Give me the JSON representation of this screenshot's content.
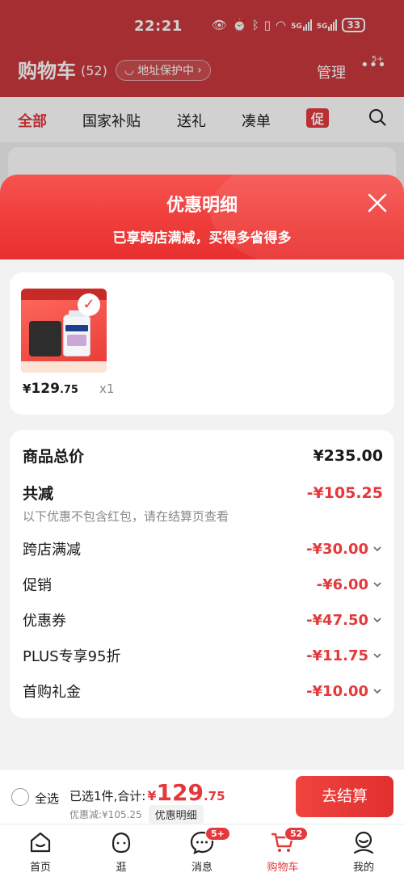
{
  "status_bar": {
    "time": "22:21",
    "battery": "33"
  },
  "header": {
    "title": "购物车",
    "count": "(52)",
    "address_protect": "地址保护中",
    "manage": "管理",
    "more_badge": "5+"
  },
  "tabs": [
    {
      "label": "全部"
    },
    {
      "label": "国家补贴"
    },
    {
      "label": "送礼"
    },
    {
      "label": "凑单"
    }
  ],
  "promo_tab": "促",
  "sheet": {
    "title": "优惠明细",
    "subtitle": "已享跨店满减，买得多省得多"
  },
  "product": {
    "currency": "¥",
    "price_int": "129",
    "price_dec": ".75",
    "qty": "x1"
  },
  "breakdown": {
    "total_label": "商品总价",
    "total_value": "¥235.00",
    "reduce_label": "共减",
    "reduce_value": "-¥105.25",
    "note": "以下优惠不包含红包，请在结算页查看",
    "items": [
      {
        "label": "跨店满减",
        "value": "-¥30.00"
      },
      {
        "label": "促销",
        "value": "-¥6.00"
      },
      {
        "label": "优惠券",
        "value": "-¥47.50"
      },
      {
        "label": "PLUS专享95折",
        "value": "-¥11.75"
      },
      {
        "label": "首购礼金",
        "value": "-¥10.00"
      }
    ]
  },
  "checkout": {
    "select_all": "全选",
    "selected_text": "已选1件,合计:",
    "total_currency": "¥",
    "total_int": "129",
    "total_dec": ".75",
    "reduced_text": "优惠减:¥105.25",
    "detail_pill": "优惠明细",
    "button": "去结算"
  },
  "nav": [
    {
      "label": "首页"
    },
    {
      "label": "逛"
    },
    {
      "label": "消息",
      "badge": "5+"
    },
    {
      "label": "购物车",
      "badge": "52"
    },
    {
      "label": "我的"
    }
  ],
  "colors": {
    "accent": "#e4393c",
    "header_bg": "#c9393d"
  }
}
